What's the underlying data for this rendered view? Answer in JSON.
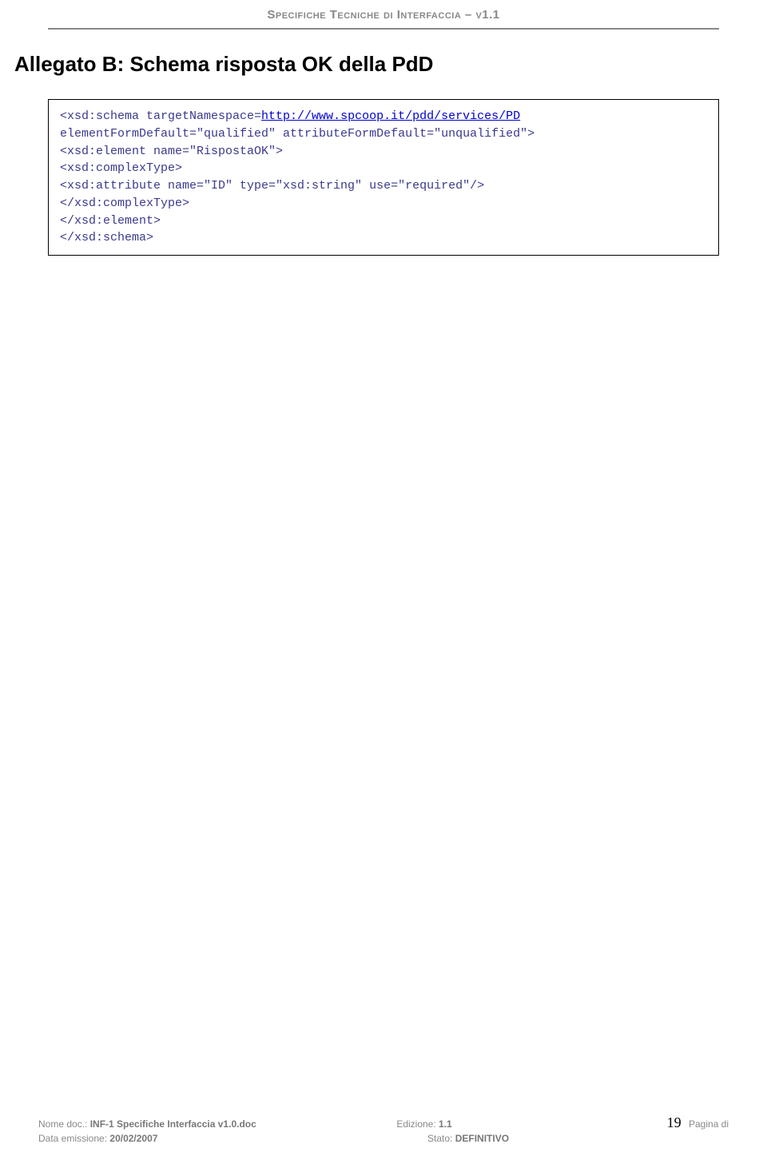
{
  "header": {
    "title": "Specifiche Tecniche di Interfaccia – v1.1"
  },
  "section": {
    "title": "Allegato B: Schema risposta OK della PdD"
  },
  "code": {
    "l1a": "<xsd:schema targetNamespace=",
    "l1link": "http://www.spcoop.it/pdd/services/PD",
    "l2": "     elementFormDefault=\"qualified\" attributeFormDefault=\"unqualified\">",
    "l3": "<xsd:element name=\"RispostaOK\">",
    "l4": "  <xsd:complexType>",
    "l5": "     <xsd:attribute name=\"ID\" type=\"xsd:string\" use=\"required\"/>",
    "l6": "  </xsd:complexType>",
    "l7": "</xsd:element>",
    "l8": "</xsd:schema>"
  },
  "footer": {
    "doc_label": "Nome doc.:",
    "doc_value": "INF-1 Specifiche Interfaccia v1.0.doc",
    "date_label": "Data emissione:",
    "date_value": "20/02/2007",
    "ed_label": "Edizione:",
    "ed_value": "1.1",
    "stato_label": "Stato:",
    "stato_value": "DEFINITIVO",
    "page_num": "19",
    "page_of": "Pagina di"
  }
}
